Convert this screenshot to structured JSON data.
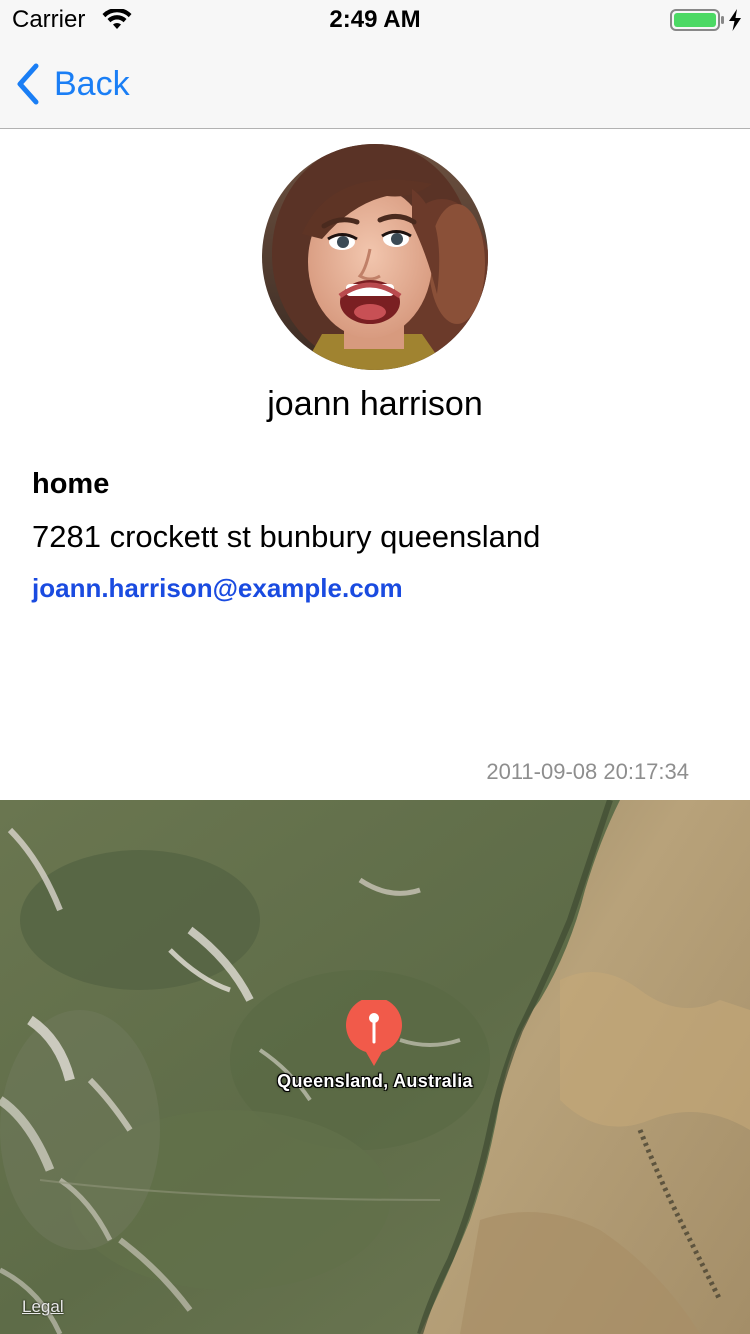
{
  "status_bar": {
    "carrier": "Carrier",
    "time": "2:49 AM",
    "icons": [
      "wifi-icon",
      "battery-icon",
      "charging-icon"
    ],
    "battery_color": "#4cd964"
  },
  "nav": {
    "back_label": "Back",
    "back_icon": "chevron-left-icon",
    "accent_color": "#1a7ef5"
  },
  "contact": {
    "name": "joann harrison",
    "address_type": "home",
    "address": "7281 crockett st bunbury queensland",
    "email": "joann.harrison@example.com",
    "email_color": "#1a4be0",
    "timestamp": "2011-09-08 20:17:34",
    "avatar_icon": "avatar-photo"
  },
  "map": {
    "pin_label": "Queensland, Australia",
    "pin_icon": "map-pin-icon",
    "pin_color": "#f15a4a",
    "legal_label": "Legal"
  }
}
